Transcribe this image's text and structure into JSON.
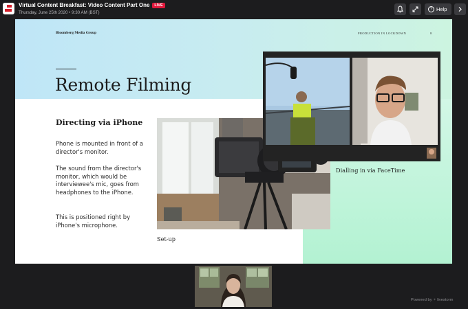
{
  "header": {
    "title": "Virtual Content Breakfast: Video Content Part One",
    "live_badge": "LIVE",
    "subtitle": "Thursday, June 25th 2020 • 9:30 AM (BST)",
    "help_label": "Help",
    "icons": [
      "app-logo",
      "bell-icon",
      "expand-icon",
      "help-icon",
      "chevron-right-icon"
    ]
  },
  "slide": {
    "brand": "Bloomberg Media Group",
    "section": "PRODUCTION IN LOCKDOWN",
    "page": "8",
    "title": "Remote Filming",
    "subheading": "Directing via iPhone",
    "paragraphs": [
      "Phone is mounted in front of a director's monitor.",
      "The sound from the director's monitor, which would be interviewee's mic, goes from headphones to the iPhone.",
      "This is positioned right by iPhone's microphone."
    ],
    "caption_setup": "Set-up",
    "caption_facetime": "Dialling in via FaceTime",
    "colors": {
      "band_start": "#bfe6f7",
      "band_end": "#ccf4e0",
      "green_panel": "#b3f2d2"
    }
  },
  "footer": {
    "powered_by": "Powered by",
    "brand": "livestorm"
  },
  "colors": {
    "background": "#1c1c1e",
    "live": "#e0183c",
    "button": "#3a3a3e"
  }
}
